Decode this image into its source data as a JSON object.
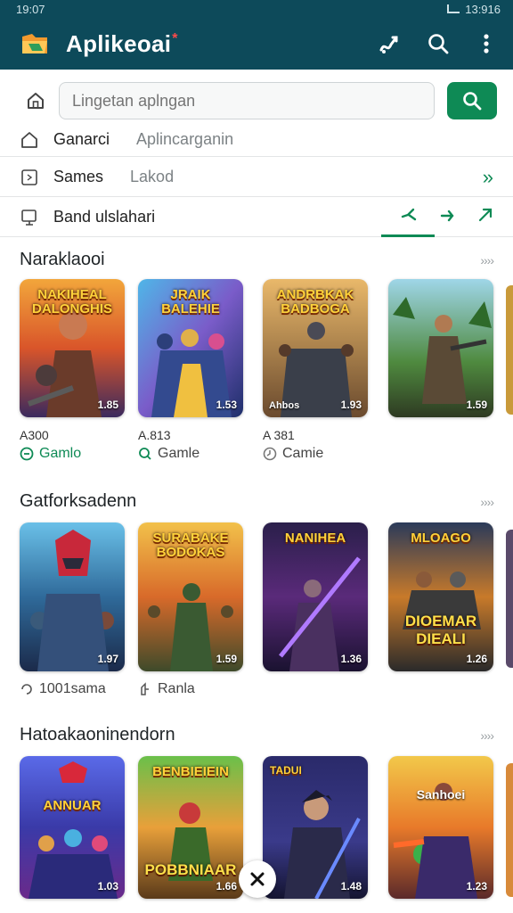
{
  "status_bar": {
    "time": "19:07",
    "right_text": "13:916"
  },
  "app_bar": {
    "title": "Aplikeoai",
    "title_mark": "*",
    "icons": [
      "logo-icon",
      "gesture-icon",
      "search-icon",
      "more-vert-icon"
    ]
  },
  "search": {
    "placeholder": "Lingetan aplngan",
    "button_icon": "search-icon"
  },
  "rows": [
    {
      "icon": "home-outline-icon",
      "label": "Ganarci",
      "sub": "Aplincarganin"
    },
    {
      "icon": "calendar-icon",
      "label": "Sames",
      "sub": "Lakod",
      "end": "»"
    },
    {
      "icon": "monitor-icon",
      "label": "Band ulslahari"
    }
  ],
  "sections": [
    {
      "title": "Naraklaooi",
      "more": "››››",
      "cards": [
        {
          "title": "NAKIHEAL DALONGHIS",
          "badge": "1.85"
        },
        {
          "title": "JRAIK BALEHIE",
          "badge": "1.53"
        },
        {
          "title": "ANDRBKAK BADBOGA",
          "badge": "1.93",
          "badge_left": "Ahbos"
        },
        {
          "title": "",
          "badge": "1.59"
        }
      ],
      "meta": [
        {
          "code": "A300",
          "tag": "Gamlo"
        },
        {
          "code": "A.813",
          "tag": "Gamle"
        },
        {
          "code": "A 381",
          "tag": "Camie"
        }
      ]
    },
    {
      "title": "Gatforksadenn",
      "more": "››››",
      "cards": [
        {
          "title": "",
          "badge": "1.97"
        },
        {
          "title": "SURABAKE BODOKAS",
          "badge": "1.59"
        },
        {
          "title": "NANIHEA",
          "badge": "1.36"
        },
        {
          "title": "MLOAGO",
          "bottom": "DIOEMAR DIEALI",
          "badge": "1.26"
        }
      ],
      "meta": [
        {
          "tag": "1001sama"
        },
        {
          "tag": "Ranla"
        }
      ]
    },
    {
      "title": "Hatoakaoninendorn",
      "more": "››››",
      "cards": [
        {
          "title": "ANNUAR",
          "badge": "1.03"
        },
        {
          "title": "BENBIEIEIN",
          "bottom": "POBBNIAAR",
          "badge": "1.66"
        },
        {
          "title": "TADUI",
          "badge": "1.48"
        },
        {
          "title": "Sanhoei",
          "badge": "1.23"
        }
      ]
    }
  ],
  "colors": {
    "app_bar": "#0d4a5a",
    "accent": "#0e8a55"
  }
}
